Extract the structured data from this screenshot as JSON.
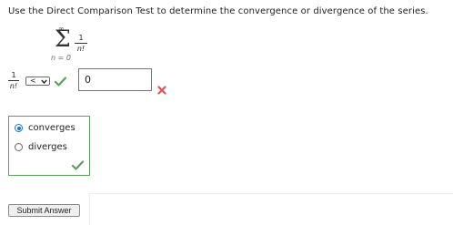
{
  "question": {
    "prompt": "Use the Direct Comparison Test to determine the convergence or divergence of the series."
  },
  "series": {
    "upper_limit": "∞",
    "symbol": "Σ",
    "lower_limit": "n = 0",
    "term_numerator": "1",
    "term_denominator": "n!"
  },
  "comparison": {
    "term_numerator": "1",
    "term_denominator": "n!",
    "selected_operator": "<",
    "operator_status": "correct",
    "input_value": "0",
    "input_status": "incorrect"
  },
  "conclusion": {
    "options": [
      "converges",
      "diverges"
    ],
    "selected": "converges",
    "status": "correct"
  },
  "actions": {
    "submit_label": "Submit Answer"
  },
  "colors": {
    "correct": "#5aa05a",
    "incorrect": "#e0525a",
    "radio_selected": "#1a6fd8"
  }
}
